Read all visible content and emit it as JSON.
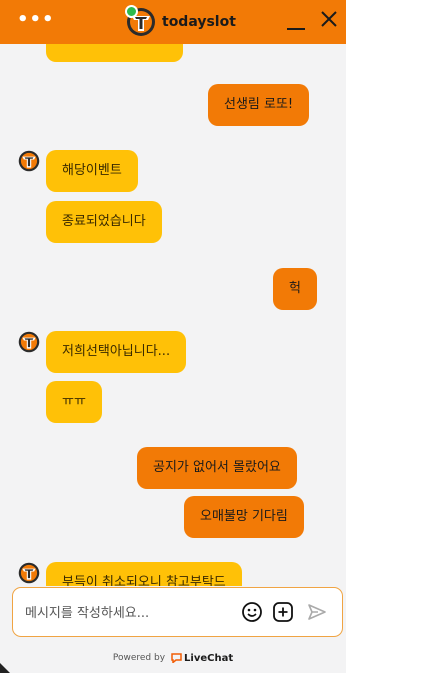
{
  "header": {
    "menu_icon": "more-dots-icon",
    "title": "todayslot",
    "minimize_icon": "minimize-icon",
    "close_icon": "close-icon",
    "online_color": "#2dba4e",
    "accent": "#f27a06"
  },
  "messages": [
    {
      "from": "agent",
      "text": ""
    },
    {
      "from": "me",
      "text": "선생림 로또!"
    },
    {
      "from": "agent",
      "text": "해당이벤트"
    },
    {
      "from": "agent",
      "text": "종료되었습니다"
    },
    {
      "from": "me",
      "text": "헉"
    },
    {
      "from": "agent",
      "text": "저희선택아닙니다..."
    },
    {
      "from": "agent",
      "text": "ㅠㅠ"
    },
    {
      "from": "me",
      "text": "공지가 없어서 몰랐어요"
    },
    {
      "from": "me",
      "text": "오매불망 기다림"
    },
    {
      "from": "agent",
      "text": "부득이 취소되오니 참고부탁드"
    }
  ],
  "composer": {
    "placeholder": "메시지를 작성하세요...",
    "emoji_icon": "emoji-icon",
    "attach_icon": "add-attachment-icon",
    "send_icon": "send-icon"
  },
  "footer": {
    "powered_by": "Powered by",
    "brand": "LiveChat",
    "brand_icon": "livechat-logo-icon"
  },
  "colors": {
    "agent_bubble": "#ffc107",
    "visitor_bubble": "#f27a06"
  }
}
